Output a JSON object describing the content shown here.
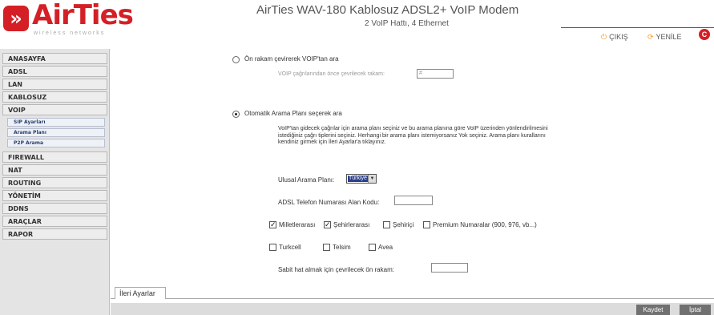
{
  "header": {
    "logo_mark": "»",
    "logo_text": "AirTies",
    "logo_tagline": "wireless networks",
    "title": "AirTies WAV-180 Kablosuz ADSL2+ VoIP Modem",
    "subtitle": "2 VoIP Hattı, 4 Ethernet",
    "exit_label": "ÇIKIŞ",
    "refresh_label": "YENİLE",
    "exit_icon": "power-icon",
    "refresh_icon": "refresh-icon",
    "close_icon": "close-icon",
    "accent_color": "#d51f26"
  },
  "sidebar": {
    "items": [
      {
        "label": "ANASAYFA"
      },
      {
        "label": "ADSL"
      },
      {
        "label": "LAN"
      },
      {
        "label": "KABLOSUZ"
      },
      {
        "label": "VOIP"
      },
      {
        "label": "FIREWALL"
      },
      {
        "label": "NAT"
      },
      {
        "label": "ROUTING"
      },
      {
        "label": "YÖNETİM"
      },
      {
        "label": "DDNS"
      },
      {
        "label": "ARAÇLAR"
      },
      {
        "label": "RAPOR"
      }
    ],
    "subitems": [
      {
        "label": "SIP Ayarları"
      },
      {
        "label": "Arama Planı"
      },
      {
        "label": "P2P Arama"
      }
    ]
  },
  "form": {
    "option1_label": "Ön rakam çevirerek VOIP'tan ara",
    "option1_field_label": "VOIP çağrılarından önce çevrilecek rakam:",
    "option1_field_value": "#",
    "option2_label": "Otomatik Arama Planı seçerek ara",
    "option2_description": "VoIP'tan gidecek çağrılar için arama planı seçiniz ve bu arama planına göre VoIP üzerinden yönlendirilmesini istediğiniz çağrı tiplerini seçiniz. Herhangi bir arama planı istemiyorsanız Yok seçiniz. Arama planı kurallarını kendiniz girmek için İleri Ayarlar'a tıklayınız.",
    "plan_label": "Ulusal Arama Planı:",
    "plan_value": "Türkiye",
    "area_code_label": "ADSL Telefon Numarası Alan Kodu:",
    "area_code_value": "",
    "check_international": "Milletlerarası",
    "check_intercity": "Şehirlerarası",
    "check_local": "Şehiriçi",
    "check_premium": "Premium Numaralar (900, 976, vb...)",
    "check_turkcell": "Turkcell",
    "check_telsim": "Telsim",
    "check_avea": "Avea",
    "landline_label": "Sabit hat almak için çevrilecek ön rakam:",
    "landline_value": "",
    "selected_option": 2
  },
  "footer": {
    "tab_advanced": "İleri Ayarlar",
    "save_label": "Kaydet",
    "cancel_label": "İptal"
  }
}
